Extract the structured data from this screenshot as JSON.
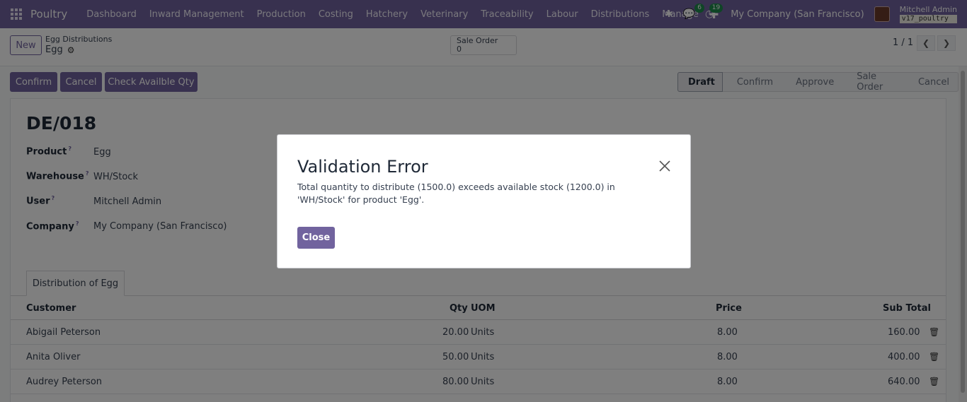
{
  "nav": {
    "brand": "Poultry",
    "menu": [
      "Dashboard",
      "Inward Management",
      "Production",
      "Costing",
      "Hatchery",
      "Veterinary",
      "Traceability",
      "Labour",
      "Distributions",
      "Manage"
    ],
    "messages_count": "6",
    "activities_count": "19",
    "company": "My Company (San Francisco)",
    "user": "Mitchell Admin",
    "db": "v17_poultry"
  },
  "control": {
    "new_label": "New",
    "breadcrumb": "Egg Distributions",
    "record": "Egg",
    "smart_label": "Sale Order",
    "smart_value": "0",
    "pager": "1 / 1"
  },
  "actions": {
    "confirm": "Confirm",
    "cancel": "Cancel",
    "check": "Check Availble Qty"
  },
  "statusbar": [
    "Draft",
    "Confirm",
    "Approve",
    "Sale Order",
    "Cancel"
  ],
  "form": {
    "title": "DE/018",
    "fields": [
      {
        "label": "Product",
        "value": "Egg"
      },
      {
        "label": "Warehouse",
        "value": "WH/Stock"
      },
      {
        "label": "User",
        "value": "Mitchell Admin"
      },
      {
        "label": "Company",
        "value": "My Company (San Francisco)"
      }
    ],
    "help_mark": "?",
    "tab": "Distribution of Egg",
    "columns": {
      "customer": "Customer",
      "qty": "Qty",
      "uom": "UOM",
      "price": "Price",
      "subtotal": "Sub Total"
    },
    "rows": [
      {
        "customer": "Abigail Peterson",
        "qty": "20.00",
        "uom": "Units",
        "price": "8.00",
        "subtotal": "160.00"
      },
      {
        "customer": "Anita Oliver",
        "qty": "50.00",
        "uom": "Units",
        "price": "8.00",
        "subtotal": "400.00"
      },
      {
        "customer": "Audrey Peterson",
        "qty": "80.00",
        "uom": "Units",
        "price": "8.00",
        "subtotal": "640.00"
      }
    ]
  },
  "dialog": {
    "title": "Validation Error",
    "message": "Total quantity to distribute (1500.0) exceeds available stock (1200.0) in 'WH/Stock' for product 'Egg'.",
    "close_label": "Close"
  },
  "colors": {
    "brand": "#71639e",
    "badge": "#1f8a4c"
  }
}
